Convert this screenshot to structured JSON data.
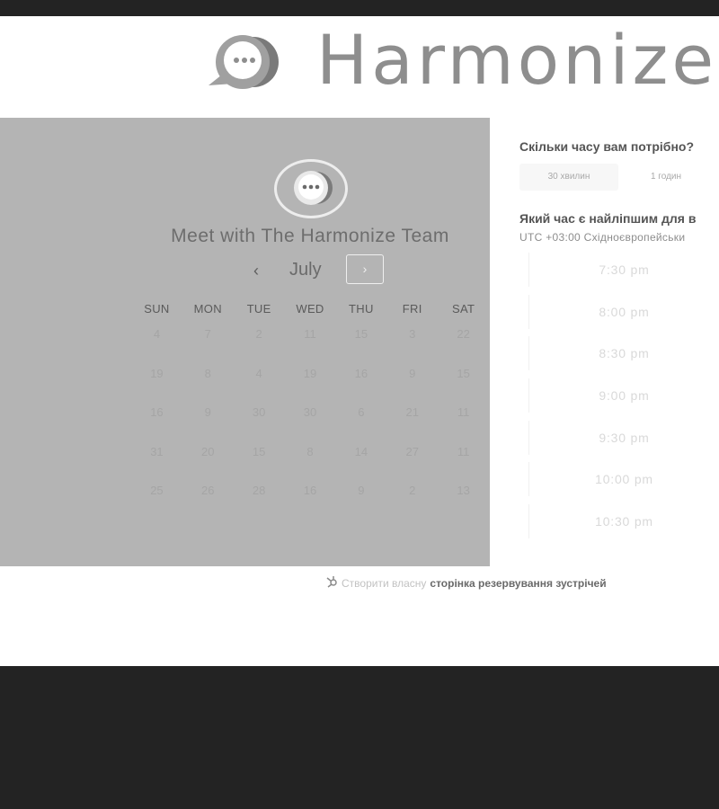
{
  "header": {
    "brand_name": "Harmonize",
    "logo_icon": "chat-bubble-logo"
  },
  "calendar": {
    "title": "Meet with The Harmonize Team",
    "month": "July",
    "prev_label": "‹",
    "next_label": "›",
    "day_headers": [
      "SUN",
      "MON",
      "TUE",
      "WED",
      "THU",
      "FRI",
      "SAT"
    ],
    "weeks": [
      [
        "4",
        "7",
        "2",
        "11",
        "15",
        "3",
        "22"
      ],
      [
        "19",
        "8",
        "4",
        "19",
        "16",
        "9",
        "15"
      ],
      [
        "16",
        "9",
        "30",
        "30",
        "6",
        "21",
        "11"
      ],
      [
        "31",
        "20",
        "15",
        "8",
        "14",
        "27",
        "11"
      ],
      [
        "25",
        "26",
        "28",
        "16",
        "9",
        "2",
        "13"
      ]
    ]
  },
  "duration": {
    "question": "Скільки часу вам потрібно?",
    "options": [
      "30 хвилин",
      "1 годин"
    ]
  },
  "time": {
    "question": "Який час є найліпшим для в",
    "timezone": "UTC +03:00 Східноєвропейськи",
    "slots": [
      "7:30 pm",
      "8:00 pm",
      "8:30 pm",
      "9:00 pm",
      "9:30 pm",
      "10:00 pm",
      "10:30 pm"
    ]
  },
  "footer": {
    "prefix": "Створити власну",
    "link": "сторінка резервування зустрічей",
    "icon": "hubspot-sprocket-icon"
  },
  "colors": {
    "page_bg": "#232323",
    "panel_bg": "#b4b4b4",
    "card_bg": "#ffffff"
  }
}
